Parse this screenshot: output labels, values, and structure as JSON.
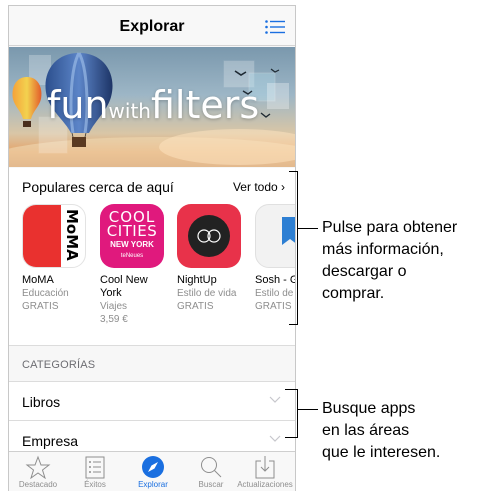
{
  "header": {
    "title": "Explorar"
  },
  "banner": {
    "title_fun": "fun",
    "title_with": "with",
    "title_filters": "filters"
  },
  "popular": {
    "title": "Populares cerca de aquí",
    "see_all": "Ver todo ›",
    "apps": [
      {
        "name": "MoMA",
        "category": "Educación",
        "price": "GRATIS",
        "icon": "moma-icon"
      },
      {
        "name": "Cool New York",
        "category": "Viajes",
        "price": "3,59 €",
        "icon": "cool-cities-icon",
        "icon_text_1": "COOL",
        "icon_text_2": "CITIES",
        "icon_text_3": "NEW YORK",
        "icon_text_4": "teNeues"
      },
      {
        "name": "NightUp",
        "category": "Estilo de vida",
        "price": "GRATIS",
        "icon": "nightup-icon"
      },
      {
        "name": "Sosh - Guide",
        "category": "Estilo de",
        "price": "GRATIS",
        "icon": "sosh-icon"
      }
    ]
  },
  "categories": {
    "label": "CATEGORÍAS",
    "items": [
      "Libros",
      "Empresa"
    ]
  },
  "tabbar": {
    "items": [
      {
        "label": "Destacado",
        "icon": "star-icon",
        "active": false
      },
      {
        "label": "Éxitos",
        "icon": "list-icon",
        "active": false
      },
      {
        "label": "Explorar",
        "icon": "compass-icon",
        "active": true
      },
      {
        "label": "Buscar",
        "icon": "search-icon",
        "active": false
      },
      {
        "label": "Actualizaciones",
        "icon": "download-icon",
        "active": false
      }
    ]
  },
  "callouts": {
    "apps_line1": "Pulse para obtener",
    "apps_line2": "más información,",
    "apps_line3": "descargar o",
    "apps_line4": "comprar.",
    "cats_line1": "Busque apps",
    "cats_line2": "en las áreas",
    "cats_line3": "que le interesen."
  },
  "colors": {
    "accent": "#1a6fe0",
    "moma_red": "#e9312f",
    "cool_pink": "#e0197d",
    "nightup_red": "#e8324a",
    "sosh_blue": "#2d7fd3"
  }
}
